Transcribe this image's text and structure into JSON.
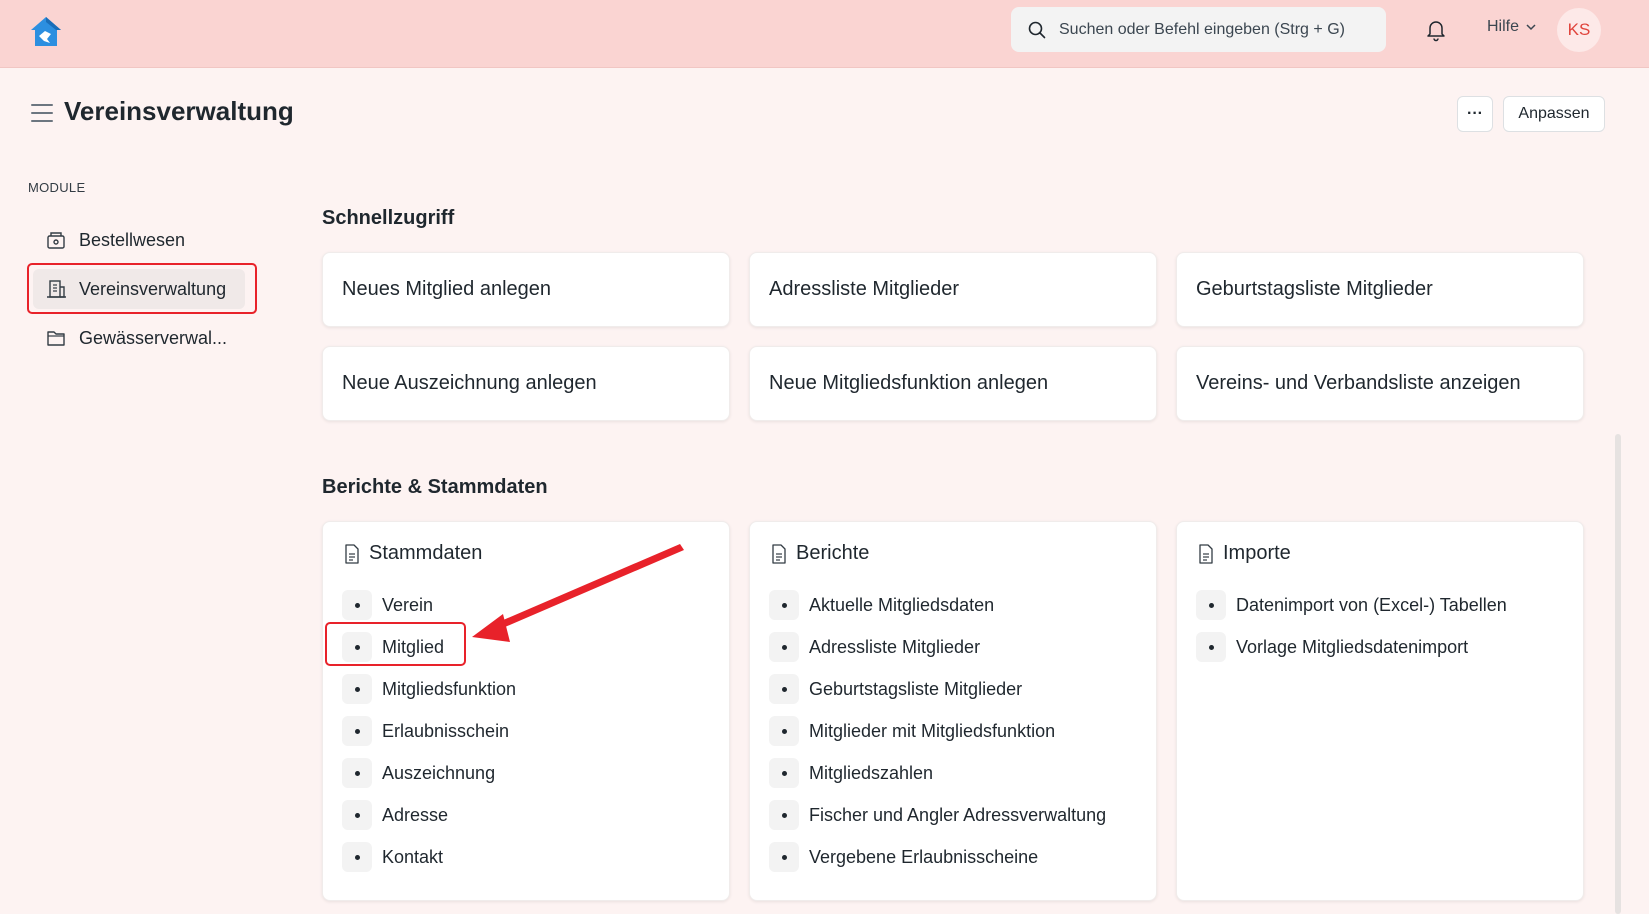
{
  "navbar": {
    "search_placeholder": "Suchen oder Befehl eingeben (Strg + G)",
    "help_label": "Hilfe",
    "avatar_initials": "KS"
  },
  "header": {
    "title": "Vereinsverwaltung",
    "more_label": "···",
    "customize_label": "Anpassen"
  },
  "sidebar": {
    "section_label": "MODULE",
    "items": [
      {
        "label": "Bestellwesen",
        "icon": "shop-icon"
      },
      {
        "label": "Vereinsverwaltung",
        "icon": "building-icon",
        "active": true
      },
      {
        "label": "Gewässerverwal...",
        "icon": "folder-icon"
      }
    ]
  },
  "quick_access": {
    "title": "Schnellzugriff",
    "shortcuts": [
      "Neues Mitglied anlegen",
      "Adressliste Mitglieder",
      "Geburtstagsliste Mitglieder",
      "Neue Auszeichnung anlegen",
      "Neue Mitgliedsfunktion anlegen",
      "Vereins- und Verbandsliste anzeigen"
    ]
  },
  "reports": {
    "title": "Berichte & Stammdaten",
    "cards": [
      {
        "title": "Stammdaten",
        "links": [
          "Verein",
          "Mitglied",
          "Mitgliedsfunktion",
          "Erlaubnisschein",
          "Auszeichnung",
          "Adresse",
          "Kontakt"
        ]
      },
      {
        "title": "Berichte",
        "links": [
          "Aktuelle Mitgliedsdaten",
          "Adressliste Mitglieder",
          "Geburtstagsliste Mitglieder",
          "Mitglieder mit Mitgliedsfunktion",
          "Mitgliedszahlen",
          "Fischer und Angler Adressverwaltung",
          "Vergebene Erlaubnisscheine"
        ]
      },
      {
        "title": "Importe",
        "links": [
          "Datenimport von (Excel-) Tabellen",
          "Vorlage Mitgliedsdatenimport"
        ]
      }
    ]
  },
  "colors": {
    "navbar": "#fad4d2",
    "page": "#fdf3f2",
    "highlight": "#e8222a",
    "brand": "#2490ef"
  }
}
